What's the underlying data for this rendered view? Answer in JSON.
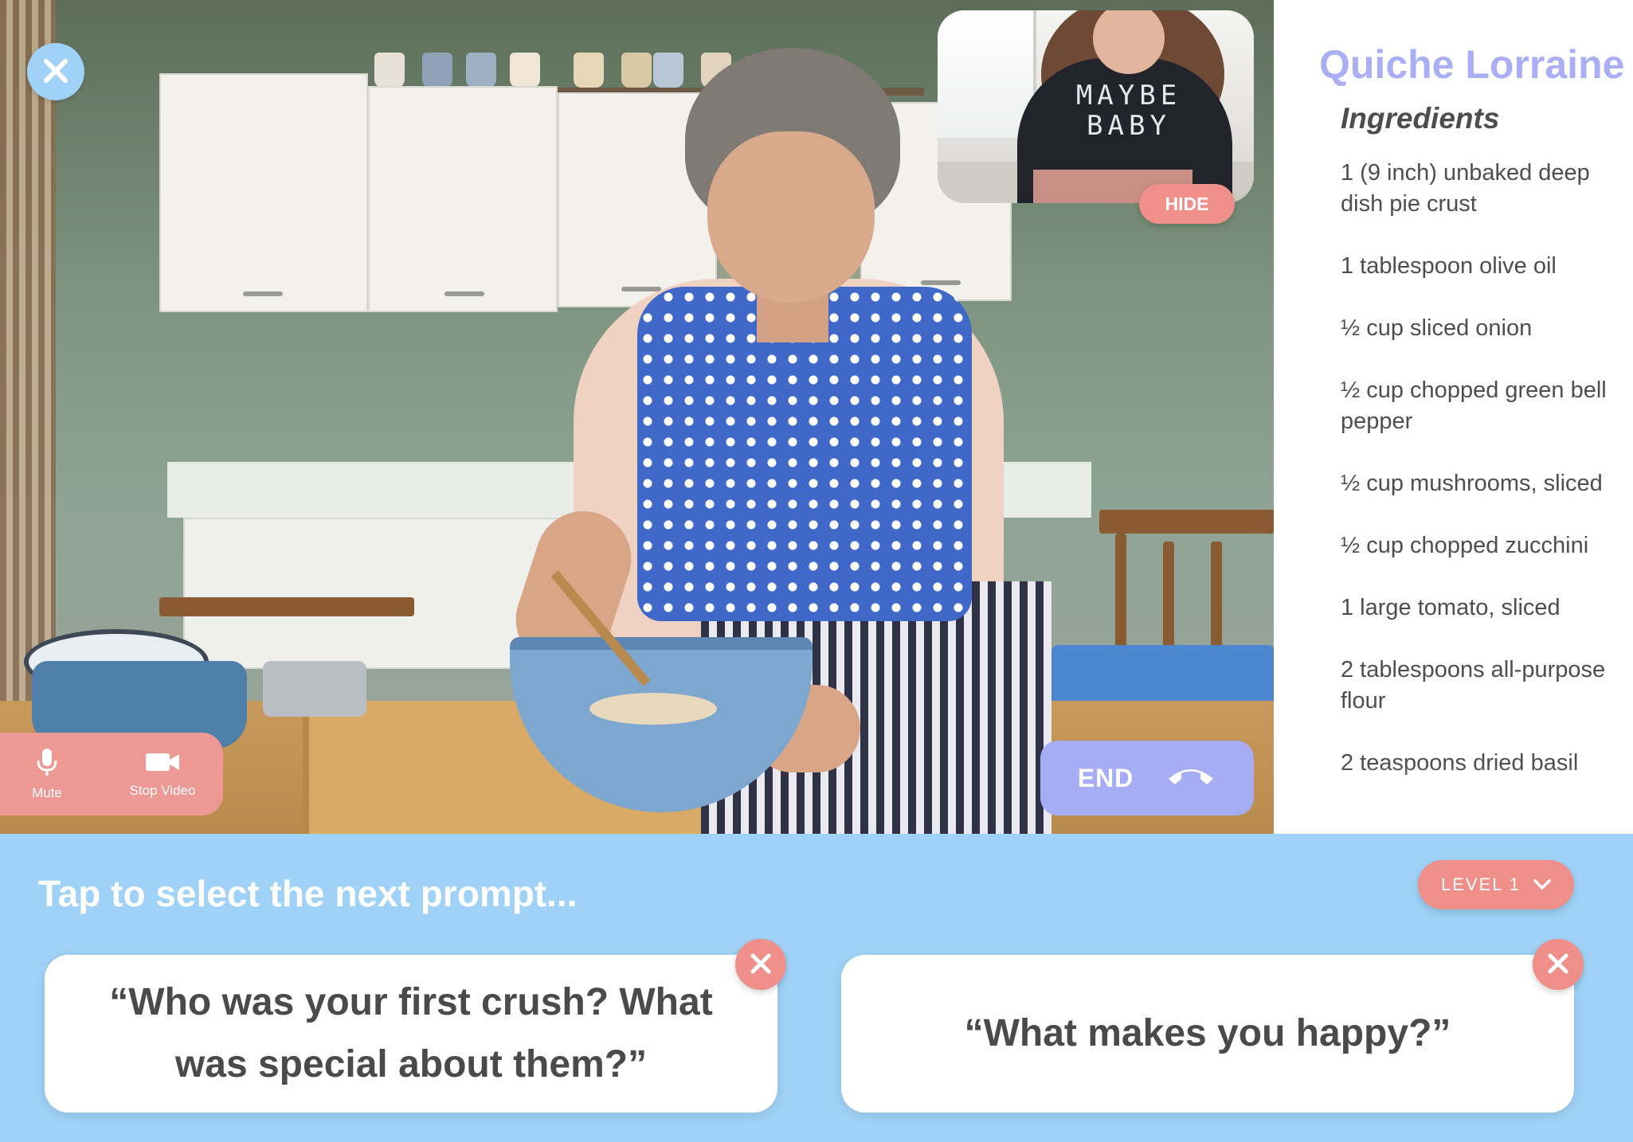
{
  "call": {
    "close_icon": "close-icon",
    "pip": {
      "shirt_text": "MAYBE BABY",
      "hide_label": "HIDE"
    },
    "controls": {
      "mute_label": "Mute",
      "mute_icon": "microphone-icon",
      "stop_video_label": "Stop Video",
      "stop_video_icon": "video-camera-icon",
      "end_label": "END",
      "end_icon": "phone-hangup-icon"
    }
  },
  "recipe": {
    "title": "Quiche Lorraine",
    "section": "Ingredients",
    "ingredients": [
      "1 (9 inch) unbaked deep dish pie crust",
      "1 tablespoon olive oil",
      "½ cup sliced onion",
      "½ cup chopped green bell pepper",
      "½ cup mushrooms, sliced",
      "½ cup chopped zucchini",
      "1 large tomato, sliced",
      "2 tablespoons all-purpose flour",
      "2 teaspoons dried basil"
    ]
  },
  "prompts": {
    "heading": "Tap to select the next prompt...",
    "level_label": "LEVEL 1",
    "cards": [
      {
        "text": "“Who was your first crush? What was special about them?”"
      },
      {
        "text": "“What makes you happy?”"
      }
    ]
  },
  "colors": {
    "accent_blue": "#9fd2f6",
    "accent_coral": "#ee8f8a",
    "accent_lavender": "#a9aef5",
    "text_dark": "#4a4a4a"
  }
}
